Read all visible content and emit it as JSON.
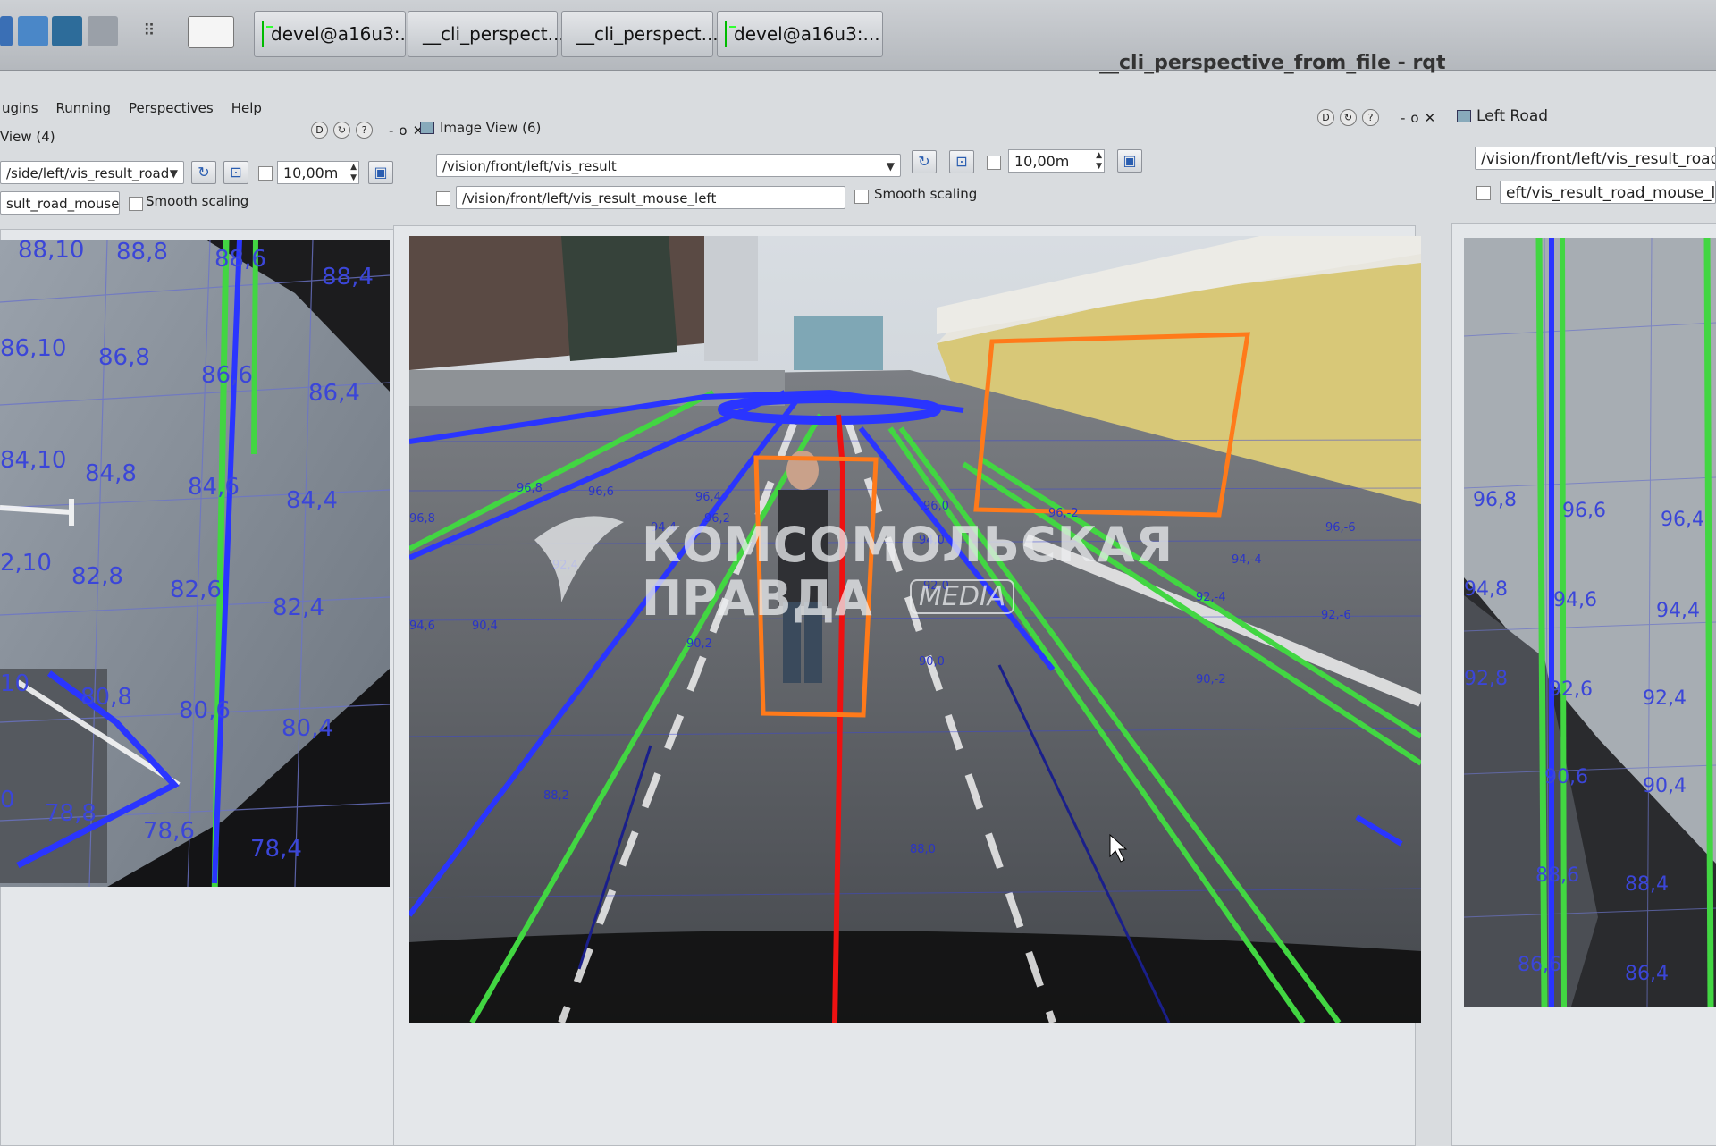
{
  "taskbar": {
    "apps": [
      {
        "label": "devel@a16u3:...",
        "icon": "terminal-icon"
      },
      {
        "label": "__cli_perspect...",
        "icon": "grid-icon"
      },
      {
        "label": "__cli_perspect...",
        "icon": "grid-icon"
      },
      {
        "label": "devel@a16u3:...",
        "icon": "terminal-icon"
      }
    ]
  },
  "window": {
    "title": "__cli_perspective_from_file - rqt"
  },
  "menu": {
    "items": [
      "ugins",
      "Running",
      "Perspectives",
      "Help"
    ]
  },
  "left_panel": {
    "title": "View (4)",
    "topic": "/side/left/vis_result_road",
    "mouse_topic": "sult_road_mouse_left",
    "range": "10,00m",
    "smooth": "Smooth scaling",
    "grid_labels": [
      "88,10",
      "88,8",
      "88,6",
      "88,4",
      "86,10",
      "86,8",
      "86,6",
      "86,4",
      "84,10",
      "84,8",
      "84,6",
      "84,4",
      "2,10",
      "82,8",
      "82,6",
      "82,4",
      "10",
      "80,8",
      "80,6",
      "80,4",
      "0",
      "78,8",
      "78,6",
      "78,4"
    ]
  },
  "center_panel": {
    "title": "Image View (6)",
    "topic": "/vision/front/left/vis_result",
    "mouse_topic": "/vision/front/left/vis_result_mouse_left",
    "range": "10,00m",
    "smooth": "Smooth scaling",
    "grid_labels": [
      "96,8",
      "96,6",
      "96,4",
      "96,2",
      "96,0",
      "96,-2",
      "96,-6",
      "94,4",
      "94,0",
      "94,-4",
      "92,4",
      "92,0",
      "92,-4",
      "92,-6",
      "90,4",
      "90,2",
      "90,0",
      "90,-2",
      "88,2",
      "88,0",
      "96,8",
      "94,6"
    ]
  },
  "right_panel": {
    "title": "Left Road",
    "topic": "/vision/front/left/vis_result_road",
    "mouse_topic": "eft/vis_result_road_mouse_le",
    "grid_labels": [
      "96,8",
      "96,6",
      "96,4",
      "94,8",
      "94,6",
      "94,4",
      "92,8",
      "92,6",
      "92,4",
      "90,6",
      "90,4",
      "88,6",
      "88,4",
      "86,6",
      "86,4"
    ]
  },
  "watermark": {
    "line1": "КОМСОМОЛЬСКАЯ",
    "line2": "ПРАВДА",
    "badge": "MEDIA"
  },
  "colors": {
    "lane_blue": "#2a35ff",
    "lane_green": "#42d642",
    "trajectory_red": "#ee1111",
    "detection_orange": "#ff7a1a"
  }
}
